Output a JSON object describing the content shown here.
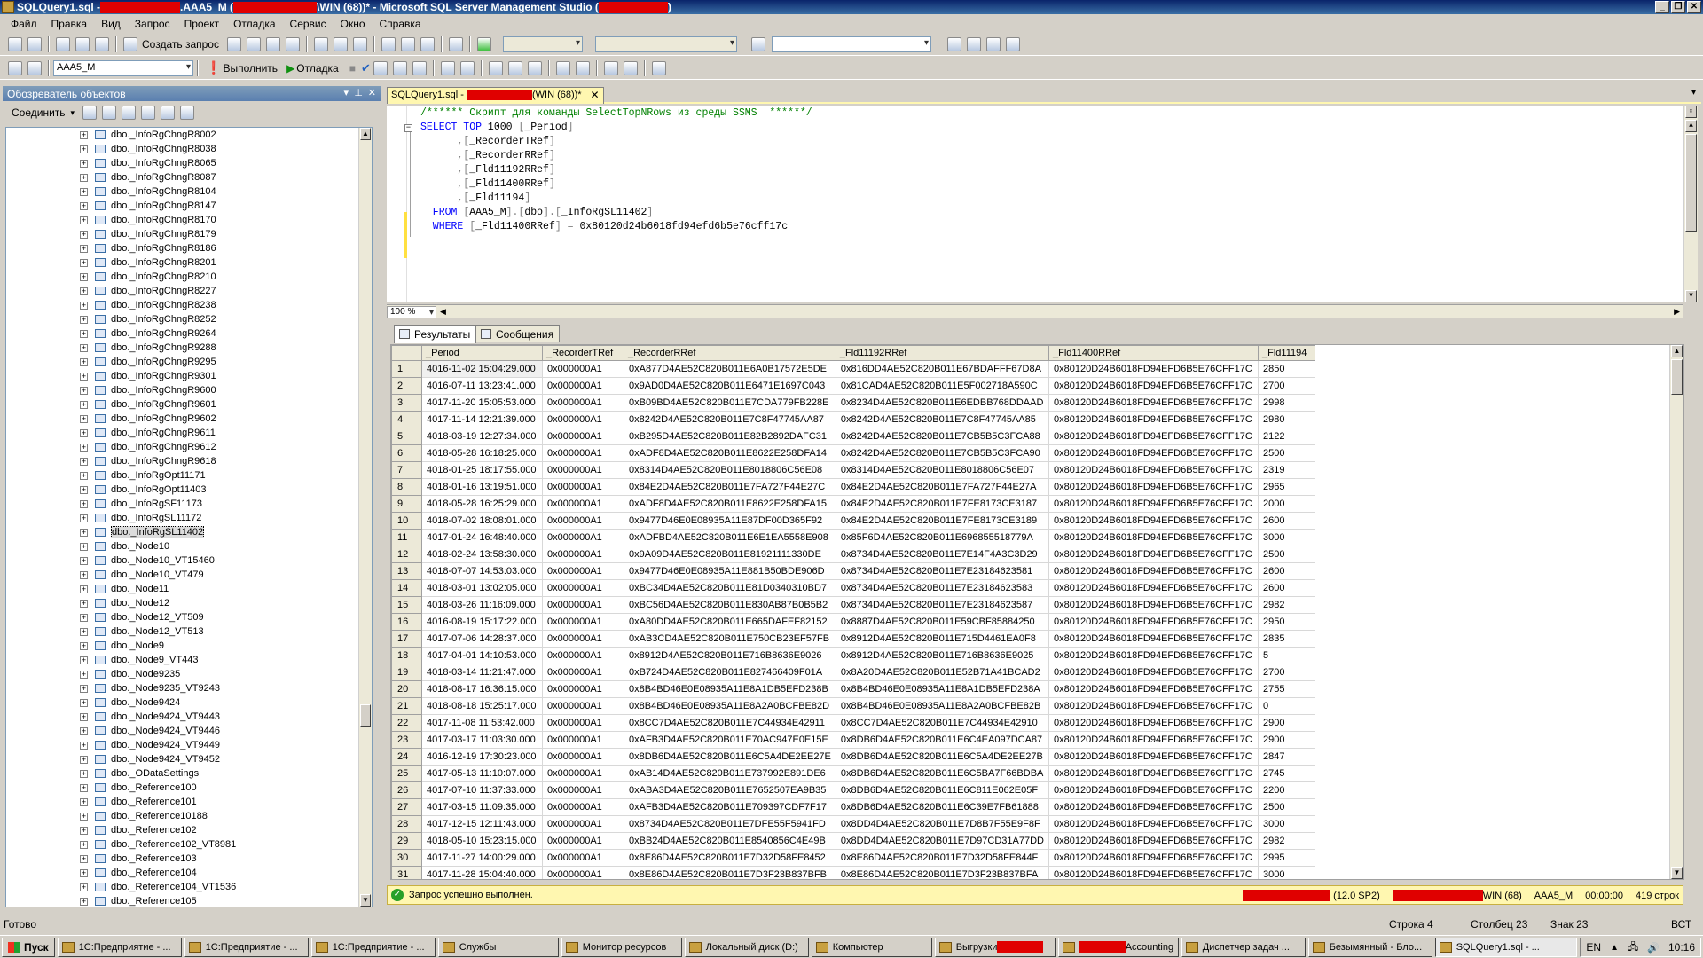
{
  "window": {
    "title_prefix": "SQLQuery1.sql - ",
    "title_mid": ".AAA5_M (",
    "title_suffix": "\\WIN (68))* - Microsoft SQL Server Management Studio (",
    "title_end": ")"
  },
  "menu": [
    "Файл",
    "Правка",
    "Вид",
    "Запрос",
    "Проект",
    "Отладка",
    "Сервис",
    "Окно",
    "Справка"
  ],
  "toolbar": {
    "new_query_label": "Создать запрос",
    "database_value": "AAA5_M",
    "execute_label": "Выполнить",
    "debug_label": "Отладка"
  },
  "object_explorer": {
    "title": "Обозреватель объектов",
    "connect_label": "Соединить",
    "items": [
      "dbo._InfoRgChngR8002",
      "dbo._InfoRgChngR8038",
      "dbo._InfoRgChngR8065",
      "dbo._InfoRgChngR8087",
      "dbo._InfoRgChngR8104",
      "dbo._InfoRgChngR8147",
      "dbo._InfoRgChngR8170",
      "dbo._InfoRgChngR8179",
      "dbo._InfoRgChngR8186",
      "dbo._InfoRgChngR8201",
      "dbo._InfoRgChngR8210",
      "dbo._InfoRgChngR8227",
      "dbo._InfoRgChngR8238",
      "dbo._InfoRgChngR8252",
      "dbo._InfoRgChngR9264",
      "dbo._InfoRgChngR9288",
      "dbo._InfoRgChngR9295",
      "dbo._InfoRgChngR9301",
      "dbo._InfoRgChngR9600",
      "dbo._InfoRgChngR9601",
      "dbo._InfoRgChngR9602",
      "dbo._InfoRgChngR9611",
      "dbo._InfoRgChngR9612",
      "dbo._InfoRgChngR9618",
      "dbo._InfoRgOpt11171",
      "dbo._InfoRgOpt11403",
      "dbo._InfoRgSF11173",
      "dbo._InfoRgSL11172",
      "dbo._InfoRgSL11402",
      "dbo._Node10",
      "dbo._Node10_VT15460",
      "dbo._Node10_VT479",
      "dbo._Node11",
      "dbo._Node12",
      "dbo._Node12_VT509",
      "dbo._Node12_VT513",
      "dbo._Node9",
      "dbo._Node9_VT443",
      "dbo._Node9235",
      "dbo._Node9235_VT9243",
      "dbo._Node9424",
      "dbo._Node9424_VT9443",
      "dbo._Node9424_VT9446",
      "dbo._Node9424_VT9449",
      "dbo._Node9424_VT9452",
      "dbo._ODataSettings",
      "dbo._Reference100",
      "dbo._Reference101",
      "dbo._Reference10188",
      "dbo._Reference102",
      "dbo._Reference102_VT8981",
      "dbo._Reference103",
      "dbo._Reference104",
      "dbo._Reference104_VT1536",
      "dbo._Reference105"
    ],
    "selected_index": 28
  },
  "document_tab": {
    "label_prefix": "SQLQuery1.sql - ",
    "label_suffix": "(WIN (68))*"
  },
  "editor": {
    "lines": [
      {
        "parts": [
          [
            "cm",
            "/****** Скрипт для команды SelectTopNRows из среды SSMS  ******/"
          ]
        ]
      },
      {
        "parts": [
          [
            "kw",
            "SELECT TOP "
          ],
          [
            "id",
            "1000 "
          ],
          [
            "op",
            "["
          ],
          [
            "id",
            "_Period"
          ],
          [
            "op",
            "]"
          ]
        ]
      },
      {
        "parts": [
          [
            "op",
            "      ,["
          ],
          [
            "id",
            "_RecorderTRef"
          ],
          [
            "op",
            "]"
          ]
        ]
      },
      {
        "parts": [
          [
            "op",
            "      ,["
          ],
          [
            "id",
            "_RecorderRRef"
          ],
          [
            "op",
            "]"
          ]
        ]
      },
      {
        "parts": [
          [
            "op",
            "      ,["
          ],
          [
            "id",
            "_Fld11192RRef"
          ],
          [
            "op",
            "]"
          ]
        ]
      },
      {
        "parts": [
          [
            "op",
            "      ,["
          ],
          [
            "id",
            "_Fld11400RRef"
          ],
          [
            "op",
            "]"
          ]
        ]
      },
      {
        "parts": [
          [
            "op",
            "      ,["
          ],
          [
            "id",
            "_Fld11194"
          ],
          [
            "op",
            "]"
          ]
        ]
      },
      {
        "parts": [
          [
            "kw",
            "  FROM "
          ],
          [
            "op",
            "["
          ],
          [
            "id",
            "AAA5_M"
          ],
          [
            "op",
            "].["
          ],
          [
            "id",
            "dbo"
          ],
          [
            "op",
            "].["
          ],
          [
            "id",
            "_InfoRgSL11402"
          ],
          [
            "op",
            "]"
          ]
        ]
      },
      {
        "parts": [
          [
            "kw",
            "  WHERE "
          ],
          [
            "op",
            "["
          ],
          [
            "id",
            "_Fld11400RRef"
          ],
          [
            "op",
            "] = "
          ],
          [
            "id",
            "0x80120d24b6018fd94efd6b5e76cff17c"
          ]
        ]
      }
    ]
  },
  "zoom_value": "100 %",
  "result_tabs": [
    "Результаты",
    "Сообщения"
  ],
  "grid": {
    "columns": [
      "_Period",
      "_RecorderTRef",
      "_RecorderRRef",
      "_Fld11192RRef",
      "_Fld11400RRef",
      "_Fld11194"
    ],
    "rows": [
      [
        "4016-11-02 15:04:29.000",
        "0x000000A1",
        "0xA877D4AE52C820B011E6A0B17572E5DE",
        "0x816DD4AE52C820B011E67BDAFFF67D8A",
        "0x80120D24B6018FD94EFD6B5E76CFF17C",
        "2850"
      ],
      [
        "4016-07-11 13:23:41.000",
        "0x000000A1",
        "0x9AD0D4AE52C820B011E6471E1697C043",
        "0x81CAD4AE52C820B011E5F002718A590C",
        "0x80120D24B6018FD94EFD6B5E76CFF17C",
        "2700"
      ],
      [
        "4017-11-20 15:05:53.000",
        "0x000000A1",
        "0xB09BD4AE52C820B011E7CDA779FB228E",
        "0x8234D4AE52C820B011E6EDBB768DDAAD",
        "0x80120D24B6018FD94EFD6B5E76CFF17C",
        "2998"
      ],
      [
        "4017-11-14 12:21:39.000",
        "0x000000A1",
        "0x8242D4AE52C820B011E7C8F47745AA87",
        "0x8242D4AE52C820B011E7C8F47745AA85",
        "0x80120D24B6018FD94EFD6B5E76CFF17C",
        "2980"
      ],
      [
        "4018-03-19 12:27:34.000",
        "0x000000A1",
        "0xB295D4AE52C820B011E82B2892DAFC31",
        "0x8242D4AE52C820B011E7CB5B5C3FCA88",
        "0x80120D24B6018FD94EFD6B5E76CFF17C",
        "2122"
      ],
      [
        "4018-05-28 16:18:25.000",
        "0x000000A1",
        "0xADF8D4AE52C820B011E8622E258DFA14",
        "0x8242D4AE52C820B011E7CB5B5C3FCA90",
        "0x80120D24B6018FD94EFD6B5E76CFF17C",
        "2500"
      ],
      [
        "4018-01-25 18:17:55.000",
        "0x000000A1",
        "0x8314D4AE52C820B011E8018806C56E08",
        "0x8314D4AE52C820B011E8018806C56E07",
        "0x80120D24B6018FD94EFD6B5E76CFF17C",
        "2319"
      ],
      [
        "4018-01-16 13:19:51.000",
        "0x000000A1",
        "0x84E2D4AE52C820B011E7FA727F44E27C",
        "0x84E2D4AE52C820B011E7FA727F44E27A",
        "0x80120D24B6018FD94EFD6B5E76CFF17C",
        "2965"
      ],
      [
        "4018-05-28 16:25:29.000",
        "0x000000A1",
        "0xADF8D4AE52C820B011E8622E258DFA15",
        "0x84E2D4AE52C820B011E7FE8173CE3187",
        "0x80120D24B6018FD94EFD6B5E76CFF17C",
        "2000"
      ],
      [
        "4018-07-02 18:08:01.000",
        "0x000000A1",
        "0x9477D46E0E08935A11E87DF00D365F92",
        "0x84E2D4AE52C820B011E7FE8173CE3189",
        "0x80120D24B6018FD94EFD6B5E76CFF17C",
        "2600"
      ],
      [
        "4017-01-24 16:48:40.000",
        "0x000000A1",
        "0xADFBD4AE52C820B011E6E1EA5558E908",
        "0x85F6D4AE52C820B011E696855518779A",
        "0x80120D24B6018FD94EFD6B5E76CFF17C",
        "3000"
      ],
      [
        "4018-02-24 13:58:30.000",
        "0x000000A1",
        "0x9A09D4AE52C820B011E81921111330DE",
        "0x8734D4AE52C820B011E7E14F4A3C3D29",
        "0x80120D24B6018FD94EFD6B5E76CFF17C",
        "2500"
      ],
      [
        "4018-07-07 14:53:03.000",
        "0x000000A1",
        "0x9477D46E0E08935A11E881B50BDE906D",
        "0x8734D4AE52C820B011E7E23184623581",
        "0x80120D24B6018FD94EFD6B5E76CFF17C",
        "2600"
      ],
      [
        "4018-03-01 13:02:05.000",
        "0x000000A1",
        "0xBC34D4AE52C820B011E81D0340310BD7",
        "0x8734D4AE52C820B011E7E23184623583",
        "0x80120D24B6018FD94EFD6B5E76CFF17C",
        "2600"
      ],
      [
        "4018-03-26 11:16:09.000",
        "0x000000A1",
        "0xBC56D4AE52C820B011E830AB87B0B5B2",
        "0x8734D4AE52C820B011E7E23184623587",
        "0x80120D24B6018FD94EFD6B5E76CFF17C",
        "2982"
      ],
      [
        "4016-08-19 15:17:22.000",
        "0x000000A1",
        "0xA80DD4AE52C820B011E665DAFEF82152",
        "0x8887D4AE52C820B011E59CBF85884250",
        "0x80120D24B6018FD94EFD6B5E76CFF17C",
        "2950"
      ],
      [
        "4017-07-06 14:28:37.000",
        "0x000000A1",
        "0xAB3CD4AE52C820B011E750CB23EF57FB",
        "0x8912D4AE52C820B011E715D4461EA0F8",
        "0x80120D24B6018FD94EFD6B5E76CFF17C",
        "2835"
      ],
      [
        "4017-04-01 14:10:53.000",
        "0x000000A1",
        "0x8912D4AE52C820B011E716B8636E9026",
        "0x8912D4AE52C820B011E716B8636E9025",
        "0x80120D24B6018FD94EFD6B5E76CFF17C",
        "5"
      ],
      [
        "4018-03-14 11:21:47.000",
        "0x000000A1",
        "0xB724D4AE52C820B011E827466409F01A",
        "0x8A20D4AE52C820B011E52B71A41BCAD2",
        "0x80120D24B6018FD94EFD6B5E76CFF17C",
        "2700"
      ],
      [
        "4018-08-17 16:36:15.000",
        "0x000000A1",
        "0x8B4BD46E0E08935A11E8A1DB5EFD238B",
        "0x8B4BD46E0E08935A11E8A1DB5EFD238A",
        "0x80120D24B6018FD94EFD6B5E76CFF17C",
        "2755"
      ],
      [
        "4018-08-18 15:25:17.000",
        "0x000000A1",
        "0x8B4BD46E0E08935A11E8A2A0BCFBE82D",
        "0x8B4BD46E0E08935A11E8A2A0BCFBE82B",
        "0x80120D24B6018FD94EFD6B5E76CFF17C",
        "0"
      ],
      [
        "4017-11-08 11:53:42.000",
        "0x000000A1",
        "0x8CC7D4AE52C820B011E7C44934E42911",
        "0x8CC7D4AE52C820B011E7C44934E42910",
        "0x80120D24B6018FD94EFD6B5E76CFF17C",
        "2900"
      ],
      [
        "4017-03-17 11:03:30.000",
        "0x000000A1",
        "0xAFB3D4AE52C820B011E70AC947E0E15E",
        "0x8DB6D4AE52C820B011E6C4EA097DCA87",
        "0x80120D24B6018FD94EFD6B5E76CFF17C",
        "2900"
      ],
      [
        "4016-12-19 17:30:23.000",
        "0x000000A1",
        "0x8DB6D4AE52C820B011E6C5A4DE2EE27E",
        "0x8DB6D4AE52C820B011E6C5A4DE2EE27B",
        "0x80120D24B6018FD94EFD6B5E76CFF17C",
        "2847"
      ],
      [
        "4017-05-13 11:10:07.000",
        "0x000000A1",
        "0xAB14D4AE52C820B011E737992E891DE6",
        "0x8DB6D4AE52C820B011E6C5BA7F66BDBA",
        "0x80120D24B6018FD94EFD6B5E76CFF17C",
        "2745"
      ],
      [
        "4017-07-10 11:37:33.000",
        "0x000000A1",
        "0xABA3D4AE52C820B011E7652507EA9B35",
        "0x8DB6D4AE52C820B011E6C811E062E05F",
        "0x80120D24B6018FD94EFD6B5E76CFF17C",
        "2200"
      ],
      [
        "4017-03-15 11:09:35.000",
        "0x000000A1",
        "0xAFB3D4AE52C820B011E709397CDF7F17",
        "0x8DB6D4AE52C820B011E6C39E7FB61888",
        "0x80120D24B6018FD94EFD6B5E76CFF17C",
        "2500"
      ],
      [
        "4017-12-15 12:11:43.000",
        "0x000000A1",
        "0x8734D4AE52C820B011E7DFE55F5941FD",
        "0x8DD4D4AE52C820B011E7D8B7F55E9F8F",
        "0x80120D24B6018FD94EFD6B5E76CFF17C",
        "3000"
      ],
      [
        "4018-05-10 15:23:15.000",
        "0x000000A1",
        "0xBB24D4AE52C820B011E8540856C4E49B",
        "0x8DD4D4AE52C820B011E7D97CD31A77DD",
        "0x80120D24B6018FD94EFD6B5E76CFF17C",
        "2982"
      ],
      [
        "4017-11-27 14:00:29.000",
        "0x000000A1",
        "0x8E86D4AE52C820B011E7D32D58FE8452",
        "0x8E86D4AE52C820B011E7D32D58FE844F",
        "0x80120D24B6018FD94EFD6B5E76CFF17C",
        "2995"
      ],
      [
        "4017-11-28 15:04:40.000",
        "0x000000A1",
        "0x8E86D4AE52C820B011E7D3F23B837BFB",
        "0x8E86D4AE52C820B011E7D3F23B837BFA",
        "0x80120D24B6018FD94EFD6B5E76CFF17C",
        "3000"
      ]
    ]
  },
  "query_status": {
    "message": "Запрос успешно выполнен.",
    "server_version": "(12.0 SP2)",
    "connection_suffix": "WIN (68)",
    "database": "AAA5_M",
    "elapsed": "00:00:00",
    "rows": "419 строк"
  },
  "statusbar": {
    "ready": "Готово",
    "line": "Строка 4",
    "col": "Столбец 23",
    "char": "Знак 23",
    "mode": "ВСТ"
  },
  "taskbar": {
    "start_label": "Пуск",
    "tasks": [
      "1С:Предприятие - ...",
      "1С:Предприятие - ...",
      "1С:Предприятие - ...",
      "Службы",
      "Монитор ресурсов",
      "Локальный диск (D:)",
      "Компьютер",
      "Выгрузки",
      "Accounting",
      "Диспетчер задач ...",
      "Безымянный - Бло...",
      "SQLQuery1.sql - ..."
    ],
    "lang": "EN",
    "clock": "10:16"
  },
  "colors": {
    "title_bar": "#0a246a",
    "editor_tab": "#fff7b0",
    "keyword": "#0000ff",
    "comment": "#008000",
    "redaction": "#e00000",
    "success": "#28a028"
  }
}
